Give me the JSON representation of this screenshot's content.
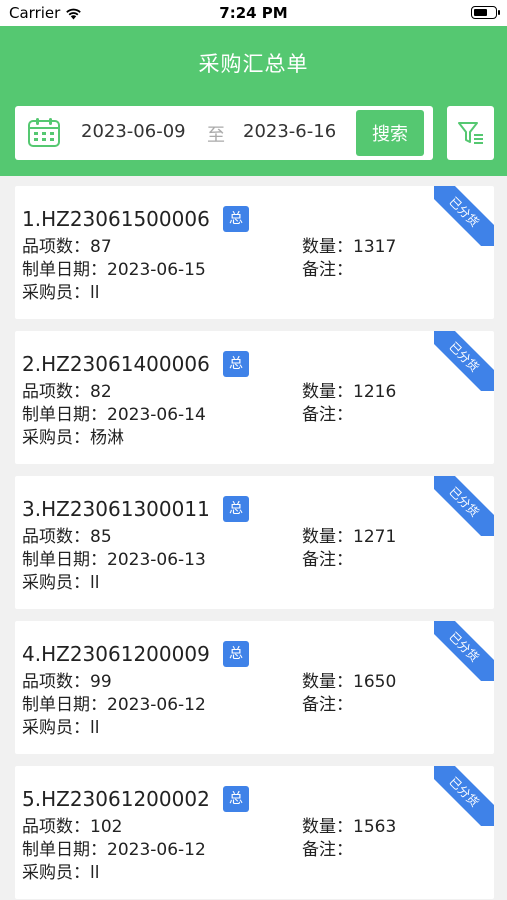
{
  "status_bar": {
    "carrier": "Carrier",
    "time": "7:24 PM"
  },
  "header": {
    "title": "采购汇总单"
  },
  "search": {
    "date_start": "2023-06-09",
    "separator": "至",
    "date_end": "2023-6-16",
    "button_label": "搜索"
  },
  "labels": {
    "item_count": "品项数：",
    "quantity": "数量：",
    "date": "制单日期：",
    "remark": "备注：",
    "buyer": "采购员：",
    "badge": "总",
    "status": "已分货"
  },
  "orders": [
    {
      "order_no": "1.HZ23061500006",
      "item_count": "87",
      "quantity": "1317",
      "date": "2023-06-15",
      "remark": "",
      "buyer": "ll"
    },
    {
      "order_no": "2.HZ23061400006",
      "item_count": "82",
      "quantity": "1216",
      "date": "2023-06-14",
      "remark": "",
      "buyer": "杨淋"
    },
    {
      "order_no": "3.HZ23061300011",
      "item_count": "85",
      "quantity": "1271",
      "date": "2023-06-13",
      "remark": "",
      "buyer": "ll"
    },
    {
      "order_no": "4.HZ23061200009",
      "item_count": "99",
      "quantity": "1650",
      "date": "2023-06-12",
      "remark": "",
      "buyer": "ll"
    },
    {
      "order_no": "5.HZ23061200002",
      "item_count": "102",
      "quantity": "1563",
      "date": "2023-06-12",
      "remark": "",
      "buyer": "ll"
    }
  ],
  "colors": {
    "primary_green": "#55c871",
    "badge_blue": "#3f82e8"
  }
}
